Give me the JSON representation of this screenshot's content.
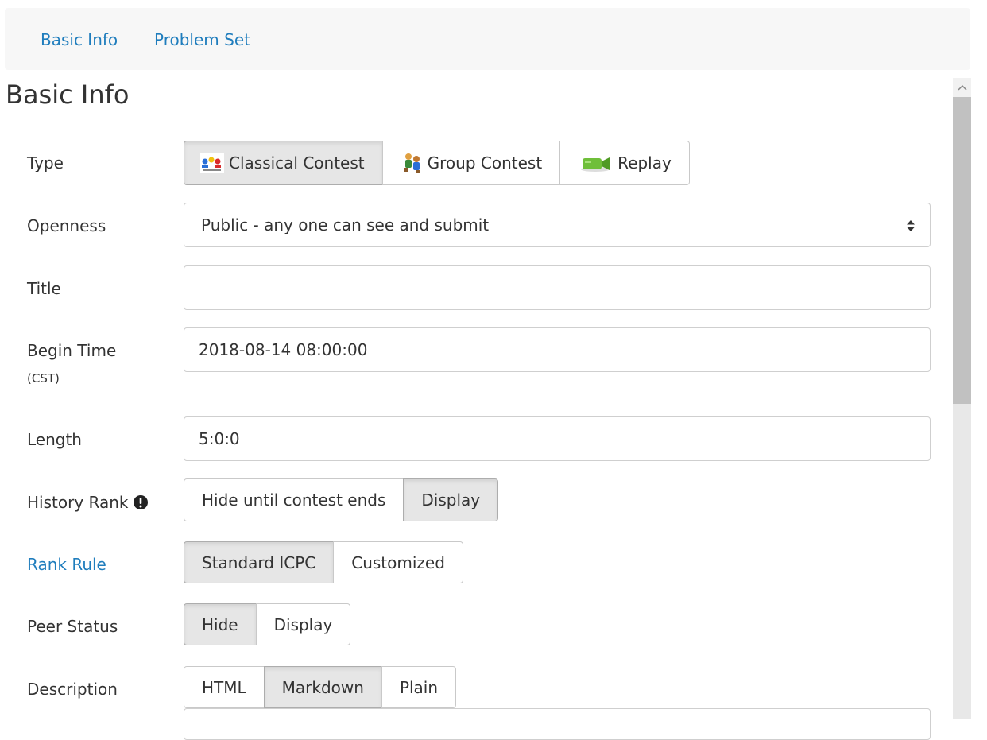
{
  "tabs": [
    {
      "label": "Basic Info"
    },
    {
      "label": "Problem Set"
    }
  ],
  "section_title": "Basic Info",
  "fields": {
    "type": {
      "label": "Type",
      "options": [
        {
          "label": "Classical Contest",
          "icon": "classical-contest-icon",
          "active": true
        },
        {
          "label": "Group Contest",
          "icon": "group-contest-icon",
          "active": false
        },
        {
          "label": "Replay",
          "icon": "replay-camera-icon",
          "active": false
        }
      ]
    },
    "openness": {
      "label": "Openness",
      "value": "Public - any one can see and submit"
    },
    "title": {
      "label": "Title",
      "value": ""
    },
    "begin_time": {
      "label": "Begin Time",
      "sublabel": "(CST)",
      "value": "2018-08-14 08:00:00"
    },
    "length": {
      "label": "Length",
      "value": "5:0:0"
    },
    "history_rank": {
      "label": "History Rank",
      "icon": "exclamation-circle-icon",
      "options": [
        {
          "label": "Hide until contest ends",
          "active": false
        },
        {
          "label": "Display",
          "active": true
        }
      ]
    },
    "rank_rule": {
      "label": "Rank Rule",
      "options": [
        {
          "label": "Standard ICPC",
          "active": true
        },
        {
          "label": "Customized",
          "active": false
        }
      ]
    },
    "peer_status": {
      "label": "Peer Status",
      "options": [
        {
          "label": "Hide",
          "active": true
        },
        {
          "label": "Display",
          "active": false
        }
      ]
    },
    "description": {
      "label": "Description",
      "options": [
        {
          "label": "HTML",
          "active": false
        },
        {
          "label": "Markdown",
          "active": true
        },
        {
          "label": "Plain",
          "active": false
        }
      ]
    }
  },
  "colors": {
    "link": "#1f7dbd",
    "active_button": "#e6e6e6",
    "tabbar_bg": "#f7f7f7"
  }
}
